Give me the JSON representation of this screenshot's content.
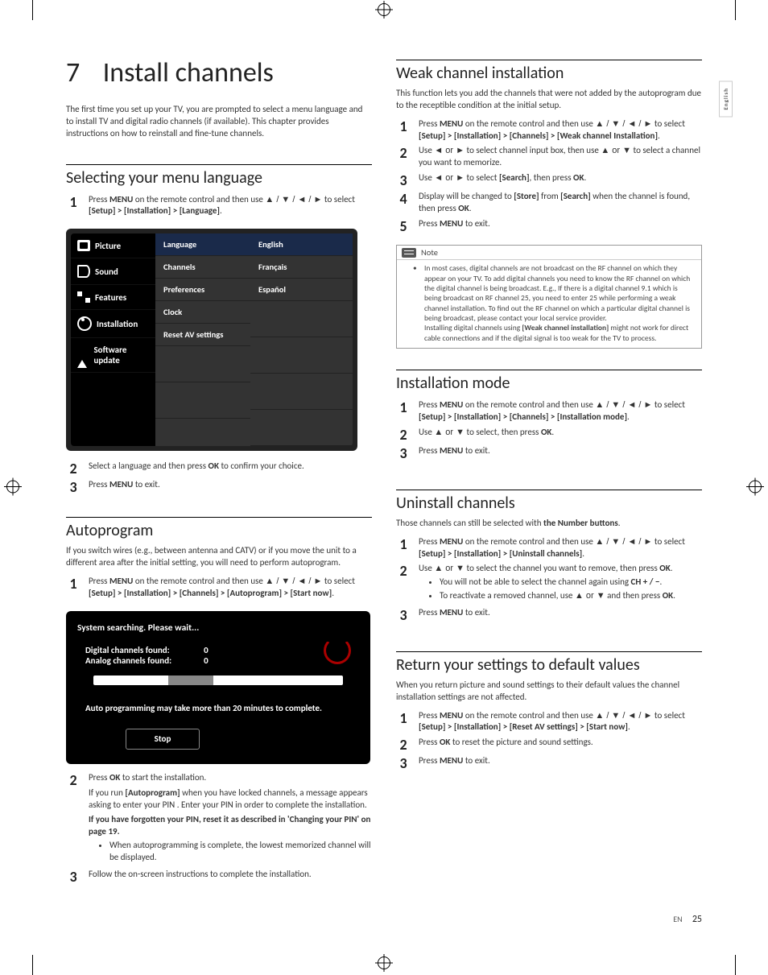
{
  "chapter": {
    "number": "7",
    "title": "Install channels"
  },
  "intro": "The first time you set up your TV, you are prompted to select a menu language and to install TV and digital radio channels (if available). This chapter provides instructions on how to reinstall and fine-tune channels.",
  "lang_section": {
    "heading": "Selecting your menu language",
    "step1_a": "Press ",
    "step1_menu": "MENU",
    "step1_b": " on the remote control and then use ",
    "step1_c": " to select ",
    "step1_path": "[Setup] > [Installation] > [Language]",
    "step2": "Select a language and then press ",
    "ok": "OK",
    "step2_b": " to confirm your choice.",
    "step3": "Press ",
    "step3_b": " to exit."
  },
  "menu": {
    "left": [
      "Picture",
      "Sound",
      "Features",
      "Installation",
      "Software update"
    ],
    "mid": [
      "Language",
      "Channels",
      "Preferences",
      "Clock",
      "Reset AV settings"
    ],
    "right": [
      "English",
      "Français",
      "Español"
    ]
  },
  "auto_section": {
    "heading": "Autoprogram",
    "intro": "If you switch wires (e.g., between antenna and CATV) or if you move the unit to a different area after the initial setting, you will need to perform autoprogram.",
    "step1_a": "Press ",
    "step1_b": " on the remote control and then use ",
    "step1_c": " to select ",
    "path": "[Setup] > [Installation] > [Channels] > [Autoprogram] > [Start now]",
    "prog_title": "System searching. Please wait...",
    "dig_label": "Digital channels found:",
    "dig_val": "0",
    "ana_label": "Analog channels found:",
    "ana_val": "0",
    "prog_note": "Auto programming may take more than 20 minutes to complete.",
    "stop": "Stop",
    "step2_a": "Press ",
    "step2_b": " to start the installation.",
    "step2_p1_a": "If you run ",
    "step2_p1_b": "[Autoprogram]",
    "step2_p1_c": " when you have locked channels, a message appears asking to enter your PIN . Enter your PIN in order to complete the installation.",
    "step2_p2": "If you have forgotten your PIN, reset it as described in 'Changing your PIN' on page 19.",
    "bullet1": "When autoprogramming is complete, the lowest memorized channel will be displayed.",
    "step3": "Follow the on-screen instructions to complete the installation."
  },
  "weak": {
    "heading": "Weak channel installation",
    "intro": "This function lets you add the channels that were not added by the autoprogram due to the receptible condition at the initial setup.",
    "s1_a": "Press ",
    "s1_b": " on the remote control and then use ",
    "s1_c": " to select ",
    "path": "[Setup] > [Installation] > [Channels] > [Weak channel Installation]",
    "s2_a": "Use ",
    "s2_b": " to select channel input box, then use ",
    "s2_c": " to select a channel you want to memorize.",
    "s3_a": "Use ",
    "s3_b": " to select ",
    "search": "[Search]",
    "s3_c": ", then press ",
    "s4_a": "Display will be changed to ",
    "store": "[Store]",
    "s4_b": " from ",
    "s4_c": " when the channel is found, then press ",
    "s5": "Press ",
    "s5_b": " to exit.",
    "note_label": "Note",
    "note_body": "In most cases, digital channels are not broadcast on the RF channel on which they appear on your TV. To add digital channels you need to know the RF channel on which the digital channel is being broadcast. E.g., If there is a digital channel 9.1 which is being broadcast on RF channel 25, you need to enter 25 while performing a weak channel installation. To find out the RF channel on which a particular digital channel is being broadcast, please contact your local service provider.",
    "note_body2_a": "Installing digital channels using ",
    "note_body2_b": "[Weak channel installation]",
    "note_body2_c": " might not work for direct cable connections and if the digital signal is too weak for the TV to process."
  },
  "inst_mode": {
    "heading": "Installation mode",
    "s1_a": "Press ",
    "s1_b": " on the remote control and then use ",
    "s1_c": " to select ",
    "path": "[Setup] > [Installation] > [Channels] > [Installation mode]",
    "s2_a": "Use ",
    "s2_b": " to select, then press ",
    "s3": "Press ",
    "s3_b": " to exit."
  },
  "uninstall": {
    "heading": "Uninstall channels",
    "intro_a": "Those channels can still be selected with ",
    "intro_b": "the Number buttons",
    "s1_a": "Press ",
    "s1_b": " on the remote control and then use ",
    "s1_c": " to select ",
    "path": "[Setup] > [Installation] > [Uninstall channels]",
    "s2_a": "Use ",
    "s2_b": " to select the channel you want to remove, then press ",
    "b1_a": "You will not be able to select the channel again using ",
    "b1_b": "CH + / −",
    "b2_a": "To reactivate a removed channel, use ",
    "b2_b": " and then press ",
    "s3": "Press ",
    "s3_b": " to exit."
  },
  "reset": {
    "heading": "Return your settings to default values",
    "intro": "When you return picture and sound settings to their default values the channel installation settings are not affected.",
    "s1_a": "Press ",
    "s1_b": " on the remote control and then use ",
    "s1_c": " to select ",
    "path": "[Setup] > [Installation] > [Reset AV settings] > [Start now]",
    "s2_a": "Press ",
    "s2_b": " to reset the picture and sound settings.",
    "s3": "Press ",
    "s3_b": " to exit."
  },
  "labels": {
    "menu": "MENU",
    "ok": "OK"
  },
  "arrows": {
    "all": "▲ / ▼ / ◄ / ►",
    "ud": "▲ or ▼",
    "lr": "◄ or ►"
  },
  "side_tab": "English",
  "footer": {
    "lang": "EN",
    "page": "25"
  }
}
